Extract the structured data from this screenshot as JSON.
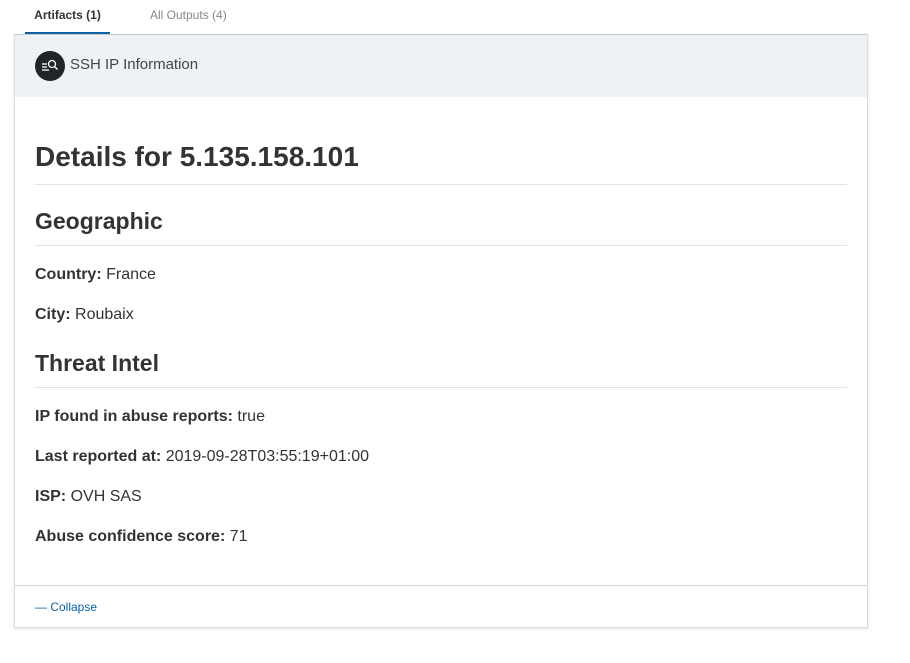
{
  "tabs": {
    "artifacts": "Artifacts (1)",
    "outputs": "All Outputs (4)"
  },
  "card": {
    "title": "SSH IP Information",
    "icon": "search-icon",
    "heading": "Details for 5.135.158.101",
    "geographic": {
      "heading": "Geographic",
      "country_label": "Country:",
      "country": "France",
      "city_label": "City:",
      "city": "Roubaix"
    },
    "threat": {
      "heading": "Threat Intel",
      "abuse_label": "IP found in abuse reports:",
      "abuse": "true",
      "reported_label": "Last reported at:",
      "reported": "2019-09-28T03:55:19+01:00",
      "isp_label": "ISP:",
      "isp": "OVH SAS",
      "score_label": "Abuse confidence score:",
      "score": "71"
    },
    "collapse": "— Collapse"
  },
  "colors": {
    "accent": "#0b63a8",
    "header_bg": "#eef2f5",
    "icon_bg": "#1f2528"
  }
}
